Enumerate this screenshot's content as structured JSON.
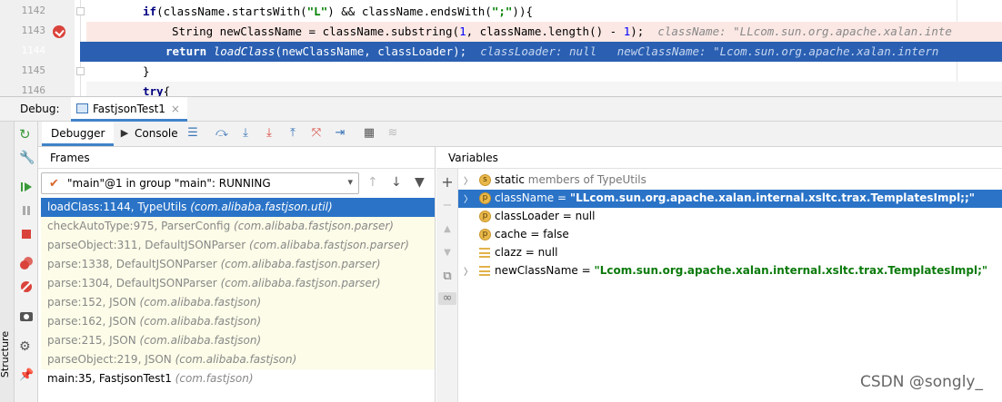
{
  "editor": {
    "lines": [
      {
        "num": "1142",
        "code_kw": "if",
        "code_a": "(className.startsWith(",
        "code_s1": "\"L\"",
        "code_b": ") && className.endsWith(",
        "code_s2": "\";\"",
        "code_c": ")){"
      },
      {
        "num": "1143",
        "code_a": "String newClassName = className.substring(",
        "code_n1": "1",
        "code_b": ", className.length() - ",
        "code_n2": "1",
        "code_c": ");",
        "inline": "className: \"LLcom.sun.org.apache.xalan.inte"
      },
      {
        "num": "1144",
        "code_kw": "return ",
        "code_fn": "loadClass",
        "code_a": "(newClassName, classLoader);",
        "inline1": "classLoader: null",
        "inline2": "newClassName: \"Lcom.sun.org.apache.xalan.intern"
      },
      {
        "num": "1145",
        "code_a": "}"
      },
      {
        "num": "1146",
        "code_kw": "try",
        "code_a": "{"
      }
    ]
  },
  "debug_bar": {
    "label": "Debug:",
    "tab": "FastjsonTest1",
    "close": "×"
  },
  "toolbar": {
    "debugger": "Debugger",
    "console": "Console"
  },
  "frames": {
    "header": "Frames",
    "thread": "\"main\"@1 in group \"main\": RUNNING",
    "items": [
      {
        "method": "loadClass:1144, TypeUtils",
        "pkg": "(com.alibaba.fastjson.util)"
      },
      {
        "method": "checkAutoType:975, ParserConfig",
        "pkg": "(com.alibaba.fastjson.parser)"
      },
      {
        "method": "parseObject:311, DefaultJSONParser",
        "pkg": "(com.alibaba.fastjson.parser)"
      },
      {
        "method": "parse:1338, DefaultJSONParser",
        "pkg": "(com.alibaba.fastjson.parser)"
      },
      {
        "method": "parse:1304, DefaultJSONParser",
        "pkg": "(com.alibaba.fastjson.parser)"
      },
      {
        "method": "parse:152, JSON",
        "pkg": "(com.alibaba.fastjson)"
      },
      {
        "method": "parse:162, JSON",
        "pkg": "(com.alibaba.fastjson)"
      },
      {
        "method": "parse:215, JSON",
        "pkg": "(com.alibaba.fastjson)"
      },
      {
        "method": "parseObject:219, JSON",
        "pkg": "(com.alibaba.fastjson)"
      },
      {
        "method": "main:35, FastjsonTest1",
        "pkg": "(com.fastjson)"
      }
    ]
  },
  "variables": {
    "header": "Variables",
    "items": [
      {
        "badge": "s",
        "name": "static",
        "rest": " members of TypeUtils"
      },
      {
        "badge": "p",
        "name": "className",
        "eq": " = ",
        "value": "\"LLcom.sun.org.apache.xalan.internal.xsltc.trax.TemplatesImpl;;\""
      },
      {
        "badge": "p",
        "name": "classLoader",
        "eq": " = ",
        "value": "null"
      },
      {
        "badge": "p",
        "name": "cache",
        "eq": " = ",
        "value": "false"
      },
      {
        "badge": "",
        "name": "clazz",
        "eq": " = ",
        "value": "null"
      },
      {
        "badge": "",
        "name": "newClassName",
        "eq": " = ",
        "value": "\"Lcom.sun.org.apache.xalan.internal.xsltc.trax.TemplatesImpl;\""
      }
    ]
  },
  "sidebar": {
    "structure": "Structure"
  },
  "watermark": "CSDN @songly_"
}
